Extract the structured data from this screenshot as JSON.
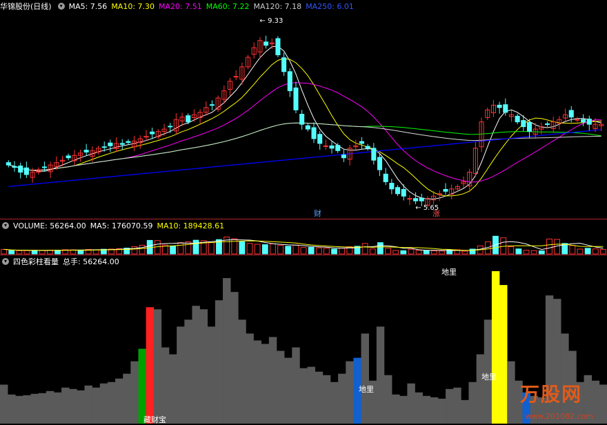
{
  "main": {
    "stock_name": "华锦股份",
    "period": "(日线)",
    "mas": [
      {
        "label": "MA5: 7.56",
        "color": "#ffffff"
      },
      {
        "label": "MA10: 7.30",
        "color": "#ffff00"
      },
      {
        "label": "MA20: 7.51",
        "color": "#ff00ff"
      },
      {
        "label": "MA60: 7.22",
        "color": "#00ff00"
      },
      {
        "label": "MA120: 7.18",
        "color": "#cccccc"
      },
      {
        "label": "MA250: 6.01",
        "color": "#0000ff"
      }
    ],
    "high_label": "9.33",
    "low_label": "5.65",
    "marker_cai": "财",
    "marker_zhang": "涨",
    "colors": {
      "up": "#ff3232",
      "down": "#54ffff",
      "bg": "#000000"
    }
  },
  "volume": {
    "title": "VOLUME: 56264.00",
    "ma5": "MA5: 176070.59",
    "ma10": "MA10: 189428.61"
  },
  "indicator": {
    "title": "四色彩柱看量",
    "total": "总手: 56264.00",
    "labels": [
      "地里",
      "地里",
      "地里"
    ],
    "bottom_label": "藏财宝"
  },
  "watermark": {
    "title": "万股网",
    "url": "www.201082.com"
  },
  "chart_data": [
    {
      "type": "candlestick",
      "title": "华锦股份 (日线)",
      "high": 9.33,
      "low": 5.65,
      "closes": [
        6.45,
        6.4,
        6.3,
        6.25,
        6.3,
        6.35,
        6.4,
        6.45,
        6.5,
        6.55,
        6.6,
        6.65,
        6.7,
        6.72,
        6.75,
        6.8,
        6.82,
        6.85,
        6.9,
        6.88,
        6.92,
        6.95,
        7.0,
        7.05,
        7.1,
        7.15,
        7.2,
        7.25,
        7.4,
        7.45,
        7.35,
        7.5,
        7.55,
        7.65,
        7.7,
        7.85,
        8.0,
        8.2,
        8.3,
        8.5,
        8.7,
        8.9,
        9.05,
        8.95,
        9.0,
        8.75,
        8.4,
        8.0,
        7.6,
        7.3,
        7.2,
        7.0,
        6.9,
        6.85,
        6.8,
        6.75,
        6.6,
        6.8,
        6.85,
        6.9,
        6.8,
        6.55,
        6.35,
        6.1,
        5.95,
        5.85,
        5.8,
        5.75,
        5.7,
        5.7,
        5.75,
        5.8,
        5.85,
        5.9,
        5.95,
        6.0,
        6.1,
        6.3,
        6.8,
        7.35,
        7.6,
        7.7,
        7.65,
        7.55,
        7.5,
        7.35,
        7.25,
        7.15,
        7.2,
        7.25,
        7.3,
        7.35,
        7.4,
        7.5,
        7.45,
        7.4,
        7.35,
        7.3,
        7.3,
        7.3
      ]
    },
    {
      "type": "bar",
      "title": "四色彩柱看量",
      "values": [
        56264,
        42000,
        40000,
        41000,
        43000,
        44000,
        47000,
        45000,
        52000,
        50000,
        48000,
        55000,
        52000,
        58000,
        60000,
        65000,
        72000,
        90000,
        108000,
        168000,
        165000,
        110000,
        100000,
        140000,
        150000,
        170000,
        165000,
        140000,
        178000,
        210000,
        190000,
        150000,
        130000,
        120000,
        115000,
        125000,
        105000,
        95000,
        110000,
        80000,
        82000,
        75000,
        70000,
        60000,
        72000,
        90000,
        95000,
        130000,
        62000,
        140000,
        70000,
        42000,
        40000,
        58000,
        45000,
        40000,
        38000,
        36000,
        50000,
        52000,
        34000,
        60000,
        100000,
        150000,
        220000,
        200000,
        90000,
        62000,
        45000,
        40000,
        38000,
        185000,
        180000,
        130000,
        105000,
        60000,
        70000,
        62000,
        56264
      ]
    }
  ]
}
